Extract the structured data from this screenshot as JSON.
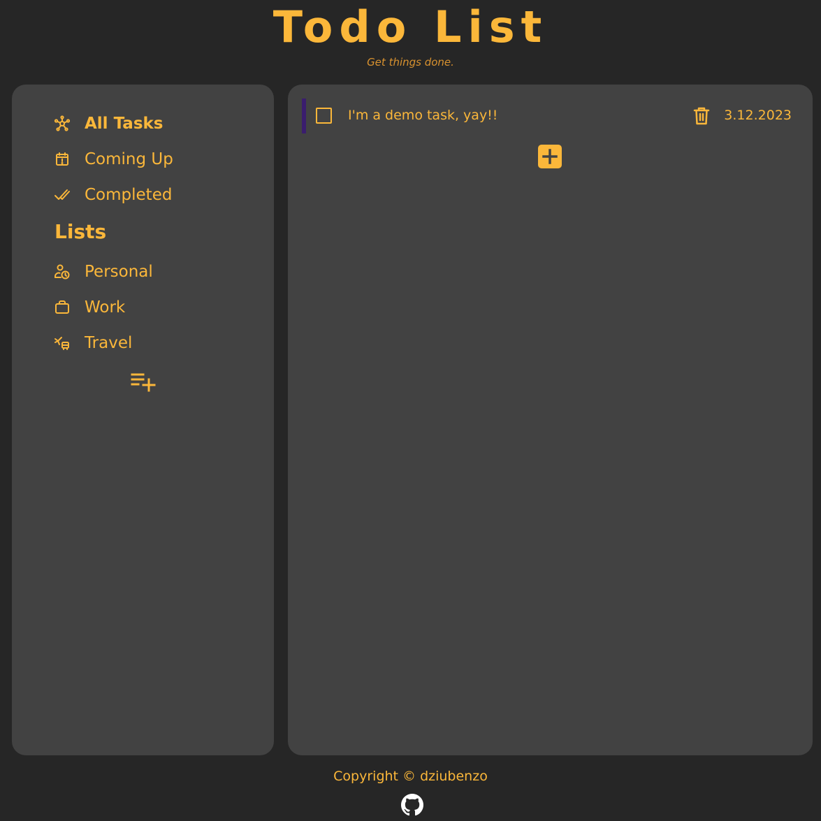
{
  "header": {
    "title": "Todo List",
    "subtitle": "Get things done."
  },
  "sidebar": {
    "nav": [
      {
        "label": "All Tasks",
        "icon": "network-icon",
        "active": true
      },
      {
        "label": "Coming Up",
        "icon": "calendar-alert-icon",
        "active": false
      },
      {
        "label": "Completed",
        "icon": "double-check-icon",
        "active": false
      }
    ],
    "lists_heading": "Lists",
    "lists": [
      {
        "label": "Personal",
        "icon": "user-clock-icon"
      },
      {
        "label": "Work",
        "icon": "briefcase-icon"
      },
      {
        "label": "Travel",
        "icon": "plane-bus-icon"
      }
    ],
    "add_list_icon": "playlist-add-icon"
  },
  "main": {
    "tasks": [
      {
        "text": "I'm a demo task, yay!!",
        "date": "3.12.2023",
        "priority_color": "#3a1d6e",
        "completed": false
      }
    ],
    "add_task_icon": "plus-square-icon"
  },
  "footer": {
    "copyright": "Copyright © dziubenzo",
    "github_icon": "github-icon"
  },
  "colors": {
    "background": "#262626",
    "panel": "#424242",
    "accent": "#fbb73a",
    "subtitle": "#d9922f"
  }
}
